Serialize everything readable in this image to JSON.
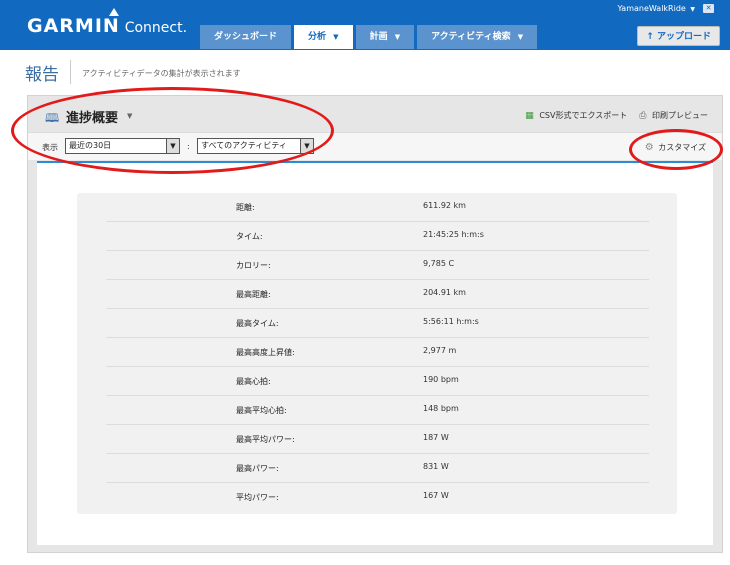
{
  "header": {
    "logo_brand": "GARMIN",
    "logo_connect": "Connect.",
    "user": "YamaneWalkRide",
    "user_caret": "▼",
    "close": "✕",
    "upload": "アップロード",
    "upload_icon": "up-arrow-icon"
  },
  "nav": {
    "tabs": [
      {
        "label": "ダッシュボード",
        "caret": ""
      },
      {
        "label": "分析",
        "caret": "▼"
      },
      {
        "label": "計画",
        "caret": "▼"
      },
      {
        "label": "アクティビティ検索",
        "caret": "▼"
      }
    ],
    "active_index": 1
  },
  "page": {
    "title": "報告",
    "subtitle": "アクティビティデータの集計が表示されます"
  },
  "report": {
    "title": "進捗概要",
    "title_caret": "▼",
    "export_csv": "CSV形式でエクスポート",
    "print_preview": "印刷プレビュー",
    "filter_label": "表示",
    "period": "最近の30日",
    "colon": ":",
    "activity_type": "すべてのアクティビティ",
    "customize": "カスタマイズ"
  },
  "stats": [
    {
      "label": "距離:",
      "value": "611.92 km"
    },
    {
      "label": "タイム:",
      "value": "21:45:25 h:m:s"
    },
    {
      "label": "カロリー:",
      "value": "9,785 C"
    },
    {
      "label": "最高距離:",
      "value": "204.91 km"
    },
    {
      "label": "最高タイム:",
      "value": "5:56:11 h:m:s"
    },
    {
      "label": "最高高度上昇値:",
      "value": "2,977 m"
    },
    {
      "label": "最高心拍:",
      "value": "190 bpm"
    },
    {
      "label": "最高平均心拍:",
      "value": "148 bpm"
    },
    {
      "label": "最高平均パワー:",
      "value": "187 W"
    },
    {
      "label": "最高パワー:",
      "value": "831 W"
    },
    {
      "label": "平均パワー:",
      "value": "167 W"
    }
  ],
  "colors": {
    "nav_blue": "#126ac0",
    "accent_blue": "#2b8bd6",
    "annotation_red": "#e21a1a"
  }
}
